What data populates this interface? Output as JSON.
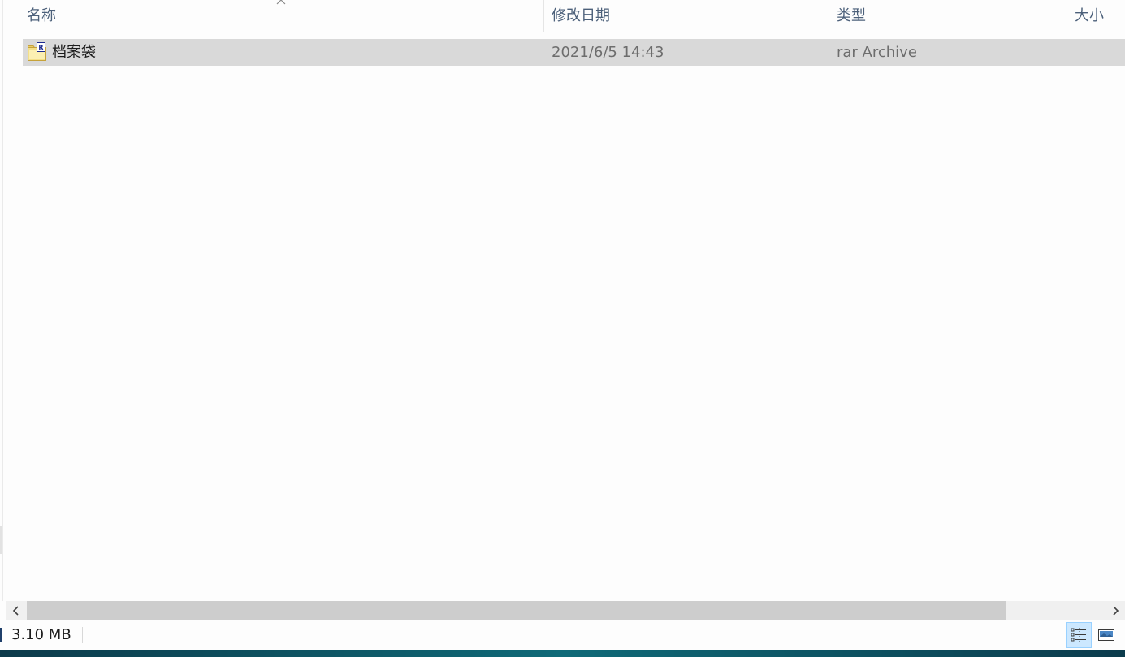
{
  "columns": {
    "name": "名称",
    "date": "修改日期",
    "type": "类型",
    "size": "大小"
  },
  "files": [
    {
      "name": "档案袋",
      "date": "2021/6/5 14:43",
      "type": "rar Archive",
      "icon": "rar-archive-icon",
      "selected": true
    }
  ],
  "status": {
    "selected_size": "3.10 MB"
  },
  "view": {
    "active": "details"
  },
  "colors": {
    "row_selected": "#d9d9d9",
    "header_text": "#4c607a",
    "details_view_active": "#cce8ff"
  }
}
